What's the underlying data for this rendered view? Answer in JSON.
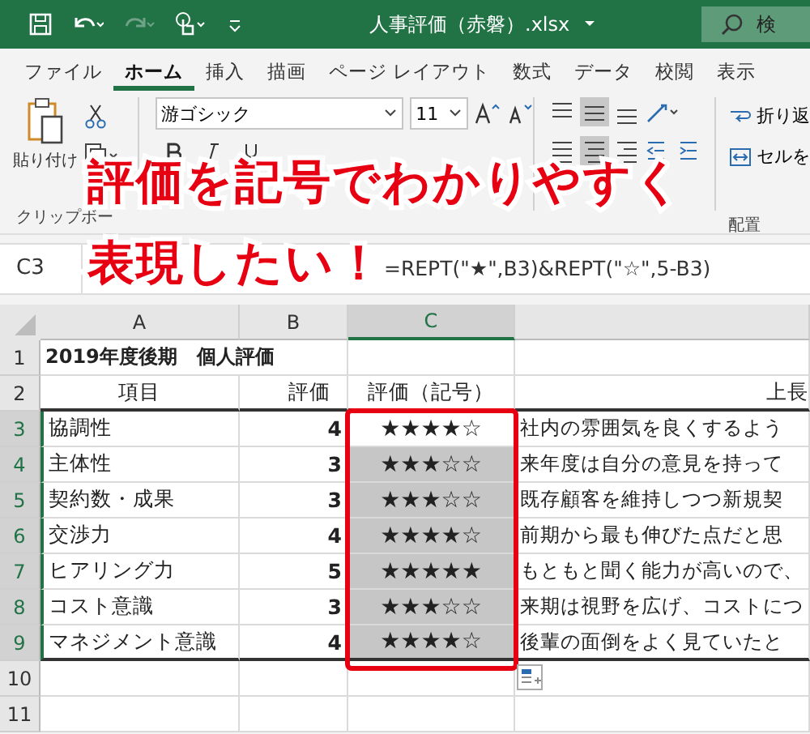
{
  "window": {
    "title": "人事評価（赤磐）.xlsx",
    "search": "検"
  },
  "tabs": [
    {
      "label": "ファイル",
      "selected": false
    },
    {
      "label": "ホーム",
      "selected": true
    },
    {
      "label": "挿入",
      "selected": false
    },
    {
      "label": "描画",
      "selected": false
    },
    {
      "label": "ページ レイアウト",
      "selected": false
    },
    {
      "label": "数式",
      "selected": false
    },
    {
      "label": "データ",
      "selected": false
    },
    {
      "label": "校閲",
      "selected": false
    },
    {
      "label": "表示",
      "selected": false
    }
  ],
  "ribbon": {
    "paste": "貼り付け",
    "font_name": "游ゴシック",
    "font_size": "11",
    "wrap": "折り返",
    "merge": "セルを",
    "groups": [
      "クリップボー",
      "配置"
    ]
  },
  "caption": [
    "評価を記号でわかりやすく",
    "表現したい！"
  ],
  "formula_bar": {
    "name_box": "C3",
    "formula": "=REPT(\"★\",B3)&REPT(\"☆\",5-B3)"
  },
  "sheet": {
    "columns": [
      {
        "label": "A",
        "selected": false
      },
      {
        "label": "B",
        "selected": false
      },
      {
        "label": "C",
        "selected": true
      }
    ],
    "rows": [
      {
        "number": "1",
        "selected": false,
        "a": "2019年度後期　個人評価"
      },
      {
        "number": "2",
        "selected": false,
        "a": "項目",
        "b": "評価",
        "c": "評価（記号）",
        "d": "上長"
      },
      {
        "number": "3",
        "selected": true,
        "active": true,
        "a": "協調性",
        "b": "4",
        "c": "★★★★☆",
        "d": "社内の雰囲気を良くするよう"
      },
      {
        "number": "4",
        "selected": true,
        "active": false,
        "a": "主体性",
        "b": "3",
        "c": "★★★☆☆",
        "d": "来年度は自分の意見を持って"
      },
      {
        "number": "5",
        "selected": true,
        "active": false,
        "a": "契約数・成果",
        "b": "3",
        "c": "★★★☆☆",
        "d": "既存顧客を維持しつつ新規契"
      },
      {
        "number": "6",
        "selected": true,
        "active": false,
        "a": "交渉力",
        "b": "4",
        "c": "★★★★☆",
        "d": "前期から最も伸びた点だと思"
      },
      {
        "number": "7",
        "selected": true,
        "active": false,
        "a": "ヒアリング力",
        "b": "5",
        "c": "★★★★★",
        "d": "もともと聞く能力が高いので、"
      },
      {
        "number": "8",
        "selected": true,
        "active": false,
        "a": "コスト意識",
        "b": "3",
        "c": "★★★☆☆",
        "d": "来期は視野を広げ、コストにつ"
      },
      {
        "number": "9",
        "selected": true,
        "active": false,
        "a": "マネジメント意識",
        "b": "4",
        "c": "★★★★☆",
        "d": "後輩の面倒をよく見ていたと"
      },
      {
        "number": "10",
        "selected": false
      },
      {
        "number": "11",
        "selected": false
      }
    ]
  }
}
